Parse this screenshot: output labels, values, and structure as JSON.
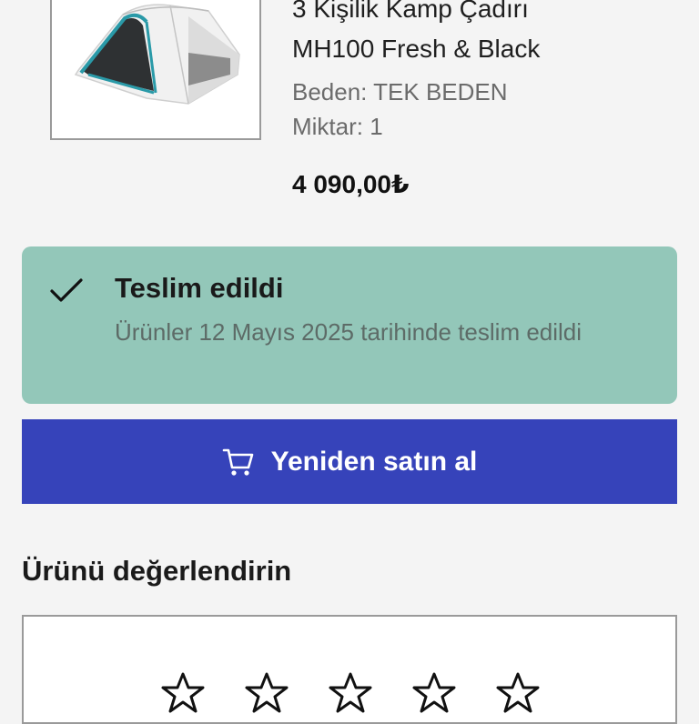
{
  "product": {
    "name_line1": "3 Kişilik Kamp Çadırı",
    "name_line2": "MH100 Fresh & Black",
    "size_label": "Beden: TEK BEDEN",
    "quantity_label": "Miktar: 1",
    "price": "4 090,00₺",
    "image_icon": "tent-image"
  },
  "delivery": {
    "title": "Teslim edildi",
    "description": "Ürünler 12 Mayıs 2025 tarihinde teslim edildi",
    "icon": "check-icon",
    "color": "#93c7b9"
  },
  "buy_again": {
    "label": "Yeniden satın al",
    "icon": "cart-icon",
    "color": "#3643ba"
  },
  "rating": {
    "title": "Ürünü değerlendirin",
    "stars": 5,
    "selected": 0,
    "icon": "star-outline-icon"
  }
}
